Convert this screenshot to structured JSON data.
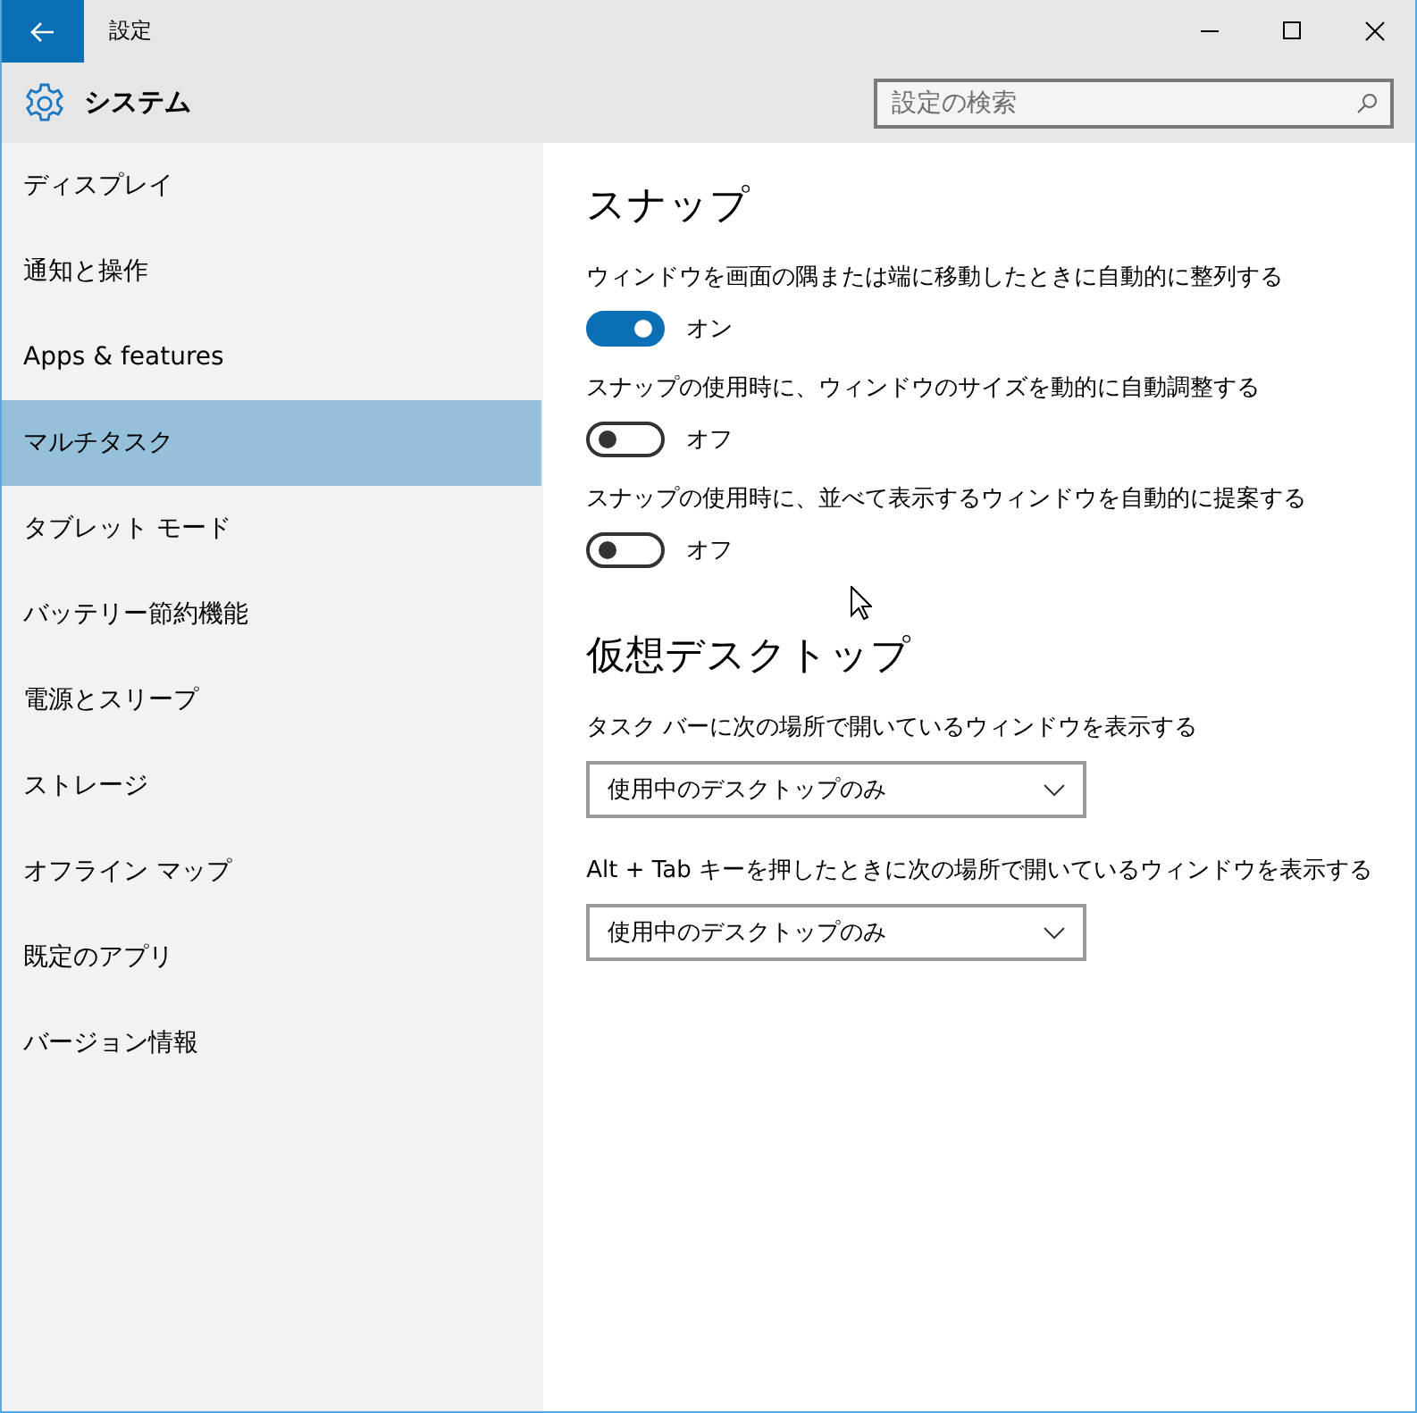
{
  "window": {
    "title": "設定"
  },
  "header": {
    "title": "システム",
    "search": {
      "placeholder": "設定の検索"
    }
  },
  "sidebar": {
    "items": [
      {
        "label": "ディスプレイ",
        "selected": false
      },
      {
        "label": "通知と操作",
        "selected": false
      },
      {
        "label": "Apps & features",
        "selected": false
      },
      {
        "label": "マルチタスク",
        "selected": true
      },
      {
        "label": "タブレット モード",
        "selected": false
      },
      {
        "label": "バッテリー節約機能",
        "selected": false
      },
      {
        "label": "電源とスリープ",
        "selected": false
      },
      {
        "label": "ストレージ",
        "selected": false
      },
      {
        "label": "オフライン マップ",
        "selected": false
      },
      {
        "label": "既定のアプリ",
        "selected": false
      },
      {
        "label": "バージョン情報",
        "selected": false
      }
    ]
  },
  "sections": [
    {
      "title": "スナップ",
      "settings": [
        {
          "kind": "toggle",
          "label": "ウィンドウを画面の隅または端に移動したときに自動的に整列する",
          "on": true,
          "state_text": "オン"
        },
        {
          "kind": "toggle",
          "label": "スナップの使用時に、ウィンドウのサイズを動的に自動調整する",
          "on": false,
          "state_text": "オフ"
        },
        {
          "kind": "toggle",
          "label": "スナップの使用時に、並べて表示するウィンドウを自動的に提案する",
          "on": false,
          "state_text": "オフ"
        }
      ]
    },
    {
      "title": "仮想デスクトップ",
      "settings": [
        {
          "kind": "dropdown",
          "label": "タスク バーに次の場所で開いているウィンドウを表示する",
          "value": "使用中のデスクトップのみ"
        },
        {
          "kind": "dropdown",
          "label": "Alt + Tab キーを押したときに次の場所で開いているウィンドウを表示する",
          "value": "使用中のデスクトップのみ"
        }
      ]
    }
  ]
}
